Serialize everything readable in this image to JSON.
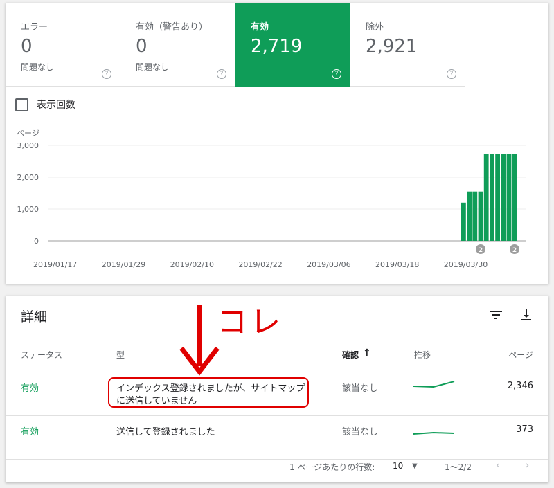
{
  "tiles": [
    {
      "label": "エラー",
      "value": "0",
      "sub": "問題なし",
      "active": false
    },
    {
      "label": "有効（警告あり）",
      "value": "0",
      "sub": "問題なし",
      "active": false
    },
    {
      "label": "有効",
      "value": "2,719",
      "sub": "",
      "active": true
    },
    {
      "label": "除外",
      "value": "2,921",
      "sub": "",
      "active": false
    }
  ],
  "impressions_checkbox": "表示回数",
  "chart_data": {
    "type": "bar",
    "ylabel": "ページ",
    "ylim": [
      0,
      3000
    ],
    "yticks": [
      "3,000",
      "2,000",
      "1,000",
      "0"
    ],
    "xticks": [
      "2019/01/17",
      "2019/01/29",
      "2019/02/10",
      "2019/02/22",
      "2019/03/06",
      "2019/03/18",
      "2019/03/30"
    ],
    "values": [
      1200,
      1550,
      1550,
      1550,
      2719,
      2719,
      2719,
      2719,
      2719,
      2719
    ],
    "annotations": [
      "2",
      "2"
    ],
    "color": "#0f9d58"
  },
  "details": {
    "title": "詳細",
    "annotation": "コレ",
    "columns": {
      "status": "ステータス",
      "type": "型",
      "confirm": "確認",
      "trend": "推移",
      "pages": "ページ"
    },
    "rows": [
      {
        "status": "有効",
        "type_line1": "インデックス登録されましたが、サイトマップ",
        "type_line2": "に送信していません",
        "confirm": "該当なし",
        "pages": "2,346"
      },
      {
        "status": "有効",
        "type_line1": "送信して登録されました",
        "type_line2": "",
        "confirm": "該当なし",
        "pages": "373"
      }
    ],
    "pager": {
      "rows_label": "1 ページあたりの行数:",
      "rows_value": "10",
      "range": "1〜2/2"
    }
  }
}
